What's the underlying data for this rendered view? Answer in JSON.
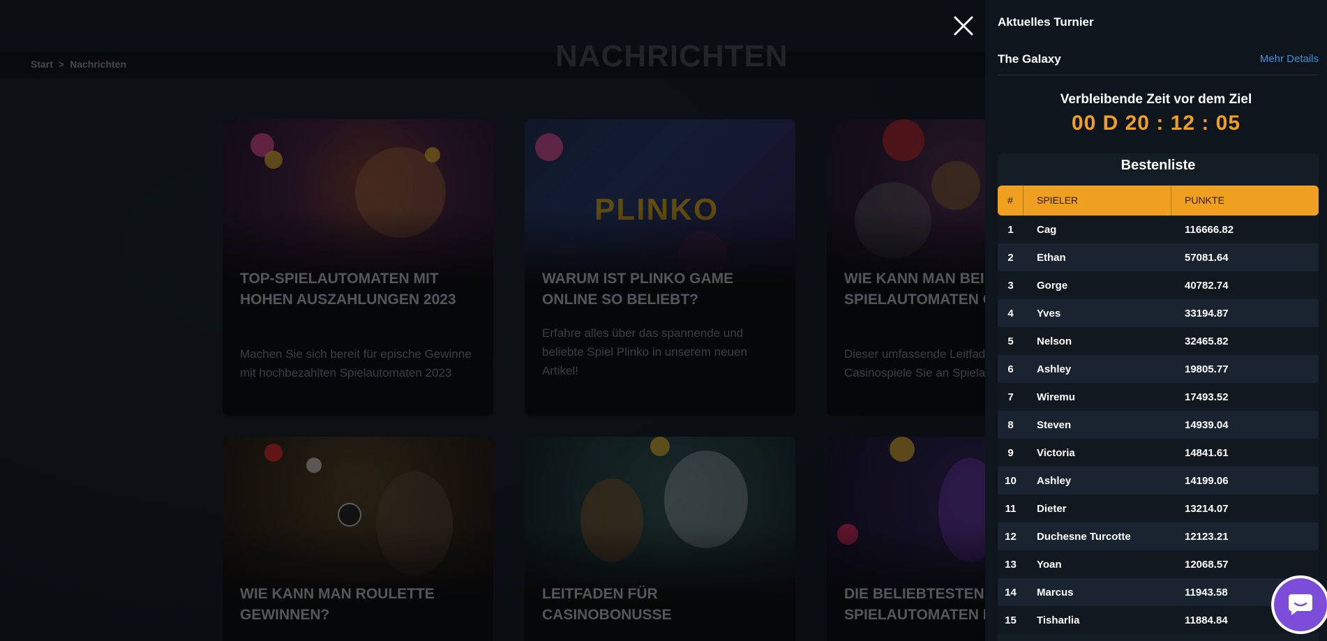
{
  "breadcrumb": {
    "home": "Start",
    "separator": ">",
    "current": "Nachrichten"
  },
  "page_title": "NACHRICHTEN",
  "cards": [
    {
      "title": "TOP-SPIELAUTOMATEN MIT HOHEN AUSZAHLUNGEN 2023",
      "description": "Machen Sie sich bereit für epische Gewinne mit hochbezahlten Spielautomaten 2023"
    },
    {
      "title": "WARUM IST PLINKO GAME ONLINE SO BELIEBT?",
      "description": "Erfahre alles über das spannende und beliebte Spiel Plinko in unserem neuen Artikel!",
      "art_text": "PLINKO"
    },
    {
      "title": "WIE KANN MAN BEI SPIELAUTOMATEN GEWINNEN?",
      "description": "Dieser umfassende Leitfaden gewinnende Casinospiele Sie an Spielautom..."
    },
    {
      "title": "WIE KANN MAN ROULETTE GEWINNEN?",
      "description": ""
    },
    {
      "title": "LEITFADEN FÜR CASINOBONUSSE",
      "description": ""
    },
    {
      "title": "DIE BELIEBTESTEN SPIELAUTOMATEN MIT HOHEM RTP",
      "description": ""
    }
  ],
  "panel": {
    "heading": "Aktuelles Turnier",
    "tournament_name": "The Galaxy",
    "more_details": "Mehr Details",
    "timer_label": "Verbleibende Zeit vor dem Ziel",
    "timer": "00 D 20 : 12 : 05",
    "leaderboard_title": "Bestenliste",
    "columns": {
      "rank": "#",
      "player": "SPIELER",
      "points": "PUNKTE"
    },
    "rows": [
      {
        "rank": "1",
        "player": "Cag",
        "points": "116666.82"
      },
      {
        "rank": "2",
        "player": "Ethan",
        "points": "57081.64"
      },
      {
        "rank": "3",
        "player": "Gorge",
        "points": "40782.74"
      },
      {
        "rank": "4",
        "player": "Yves",
        "points": "33194.87"
      },
      {
        "rank": "5",
        "player": "Nelson",
        "points": "32465.82"
      },
      {
        "rank": "6",
        "player": "Ashley",
        "points": "19805.77"
      },
      {
        "rank": "7",
        "player": "Wiremu",
        "points": "17493.52"
      },
      {
        "rank": "8",
        "player": "Steven",
        "points": "14939.04"
      },
      {
        "rank": "9",
        "player": "Victoria",
        "points": "14841.61"
      },
      {
        "rank": "10",
        "player": "Ashley",
        "points": "14199.06"
      },
      {
        "rank": "11",
        "player": "Dieter",
        "points": "13214.07"
      },
      {
        "rank": "12",
        "player": "Duchesne Turcotte",
        "points": "12123.21"
      },
      {
        "rank": "13",
        "player": "Yoan",
        "points": "12068.57"
      },
      {
        "rank": "14",
        "player": "Marcus",
        "points": "11943.58"
      },
      {
        "rank": "15",
        "player": "Tisharlia",
        "points": "11884.84"
      }
    ]
  },
  "icons": {
    "close": "close-icon",
    "chat": "chat-icon"
  },
  "colors": {
    "accent": "#f0a020",
    "link": "#3d8fd6",
    "chat": "#7c4dd9"
  }
}
